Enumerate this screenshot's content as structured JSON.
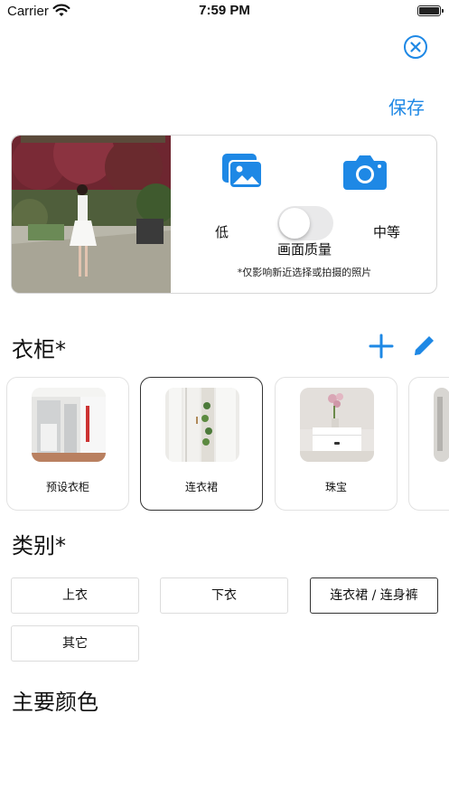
{
  "status_bar": {
    "carrier": "Carrier",
    "time": "7:59 PM"
  },
  "header": {
    "save_label": "保存",
    "close_icon": "close-circle-icon"
  },
  "photo_section": {
    "quality_low": "低",
    "quality_medium": "中等",
    "quality_label": "画面质量",
    "note": "*仅影响新近选择或拍摄的照片",
    "toggle_on": false
  },
  "wardrobe": {
    "title": "衣柜*",
    "items": [
      {
        "label": "预设衣柜",
        "selected": false
      },
      {
        "label": "连衣裙",
        "selected": true
      },
      {
        "label": "珠宝",
        "selected": false
      },
      {
        "label": "",
        "selected": false
      }
    ]
  },
  "category": {
    "title": "类别*",
    "options": [
      {
        "label": "上衣",
        "selected": false
      },
      {
        "label": "下衣",
        "selected": false
      },
      {
        "label": "连衣裙 / 连身裤",
        "selected": true
      },
      {
        "label": "其它",
        "selected": false
      }
    ]
  },
  "main_color": {
    "title": "主要颜色"
  },
  "colors": {
    "accent": "#1e88e5",
    "toggle_off": "#e9e9ea"
  }
}
